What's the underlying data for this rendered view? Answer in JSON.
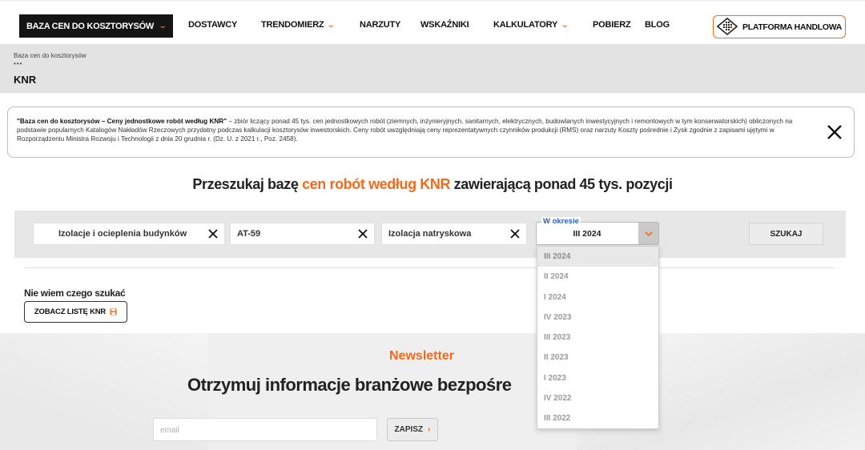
{
  "nav": {
    "primary_label": "BAZA CEN DO KOSZTORYSÓW",
    "items": [
      {
        "label": "DOSTAWCY",
        "has_dropdown": false
      },
      {
        "label": "TRENDOMIERZ",
        "has_dropdown": true
      },
      {
        "label": "NARZUTY",
        "has_dropdown": false
      },
      {
        "label": "WSKAŹNIKI",
        "has_dropdown": false
      },
      {
        "label": "KALKULATORY",
        "has_dropdown": true
      },
      {
        "label": "POBIERZ",
        "has_dropdown": false
      },
      {
        "label": "BLOG",
        "has_dropdown": false
      }
    ],
    "platform_label": "PLATFORMA HANDLOWA"
  },
  "breadcrumb": {
    "path": "Baza cen do kosztorysów",
    "dots": "•••",
    "title": "KNR"
  },
  "info": {
    "bold": "\"Baza cen do kosztorysów – Ceny jednostkowe robót według KNR\"",
    "text": " – zbiór liczący ponad 45 tys. cen jednostkowych robót (ziemnych, inżynieryjnych, sanitarnych, elektrycznych, budowlanych inwestycyjnych i remontowych w tym konserwatorskich) obliczonych na podstawie popularnych Katalogów Nakładów Rzeczowych przydatny podczas kalkulacji kosztorysów inwestorskich. Ceny robót uwzględniają ceny reprezentatywnych czynników produkcji (RMS) oraz narzuty Koszty pośrednie i Zysk zgodnie z zapisami ujętymi w Rozporządzeniu Ministra Rozwoju i Technologii z dnia 20 grudnia r. (Dz. U. z 2021 r., Poz. 2458)."
  },
  "heading": {
    "before": "Przeszukaj bazę ",
    "highlight": "cen robót według KNR",
    "after": " zawierającą ponad 45 tys. pozycji"
  },
  "search": {
    "field1": "Izolacje i ocieplenia budynków",
    "field2": "AT-59",
    "field3": "Izolacja natryskowa",
    "period_legend": "W okresie",
    "period_value": "III 2024",
    "button": "SZUKAJ",
    "period_options": [
      "III 2024",
      "II 2024",
      "I 2024",
      "IV 2023",
      "III 2023",
      "II 2023",
      "I 2023",
      "IV 2022",
      "III 2022"
    ],
    "selected_index": 0
  },
  "help": {
    "question": "Nie wiem czego szukać",
    "button": "ZOBACZ LISTĘ KNR"
  },
  "newsletter": {
    "label": "Newsletter",
    "headline": "Otrzymuj informacje branżowe bezpośre",
    "email_placeholder": "email",
    "button": "ZAPISZ"
  },
  "colors": {
    "accent": "#f26a1b",
    "dark": "#151515",
    "legend_blue": "#2a63b8"
  }
}
